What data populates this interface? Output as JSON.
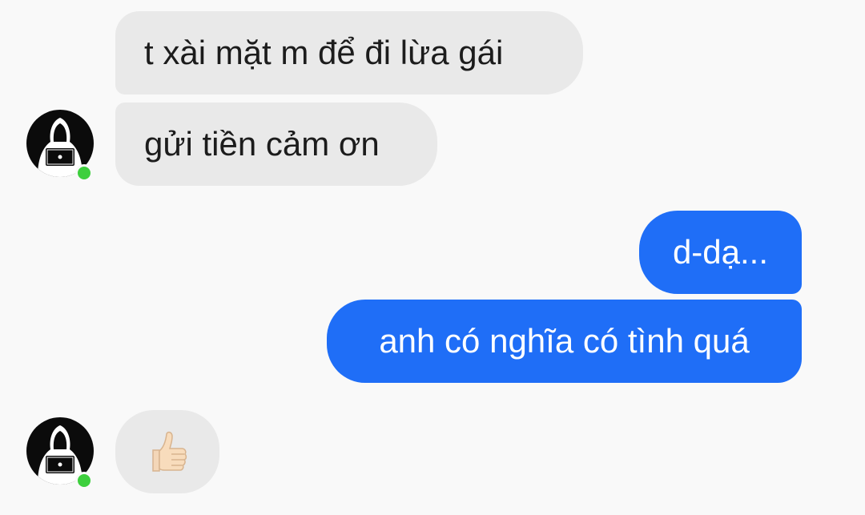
{
  "chat": {
    "messages": [
      {
        "sender": "other",
        "text": "t xài mặt m để đi lừa gái"
      },
      {
        "sender": "other",
        "text": "gửi tiền cảm ơn"
      },
      {
        "sender": "me",
        "text": "d-dạ..."
      },
      {
        "sender": "me",
        "text": "anh có nghĩa có tình quá"
      },
      {
        "sender": "other",
        "text": "👍🏻",
        "type": "emoji"
      }
    ]
  },
  "avatar": {
    "icon": "hooded-hacker-icon",
    "status": "online"
  },
  "colors": {
    "background": "#f9f9f9",
    "incoming_bubble": "#e9e9e9",
    "outgoing_bubble": "#1f6ef7",
    "online_dot": "#3dcf3d"
  }
}
